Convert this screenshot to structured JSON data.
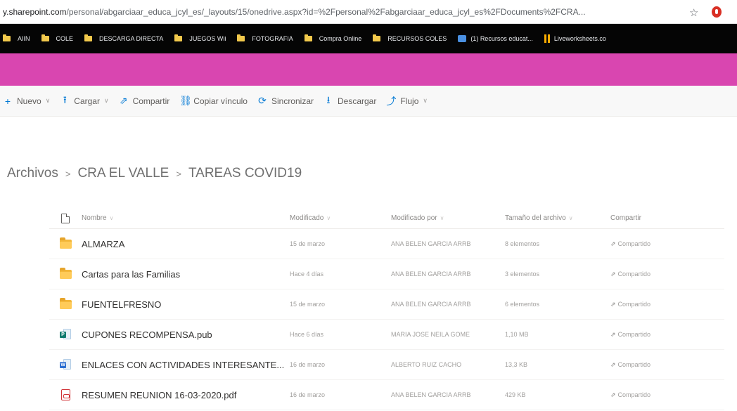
{
  "browser": {
    "url_host": "y.sharepoint.com",
    "url_path": "/personal/abgarciaar_educa_jcyl_es/_layouts/15/onedrive.aspx?id=%2Fpersonal%2Fabgarciaar_educa_jcyl_es%2FDocuments%2FCRA..."
  },
  "bookmarks": [
    {
      "label": "AIIN",
      "type": "folder"
    },
    {
      "label": "COLE",
      "type": "folder"
    },
    {
      "label": "DESCARGA DIRECTA",
      "type": "folder"
    },
    {
      "label": "JUEGOS Wii",
      "type": "folder"
    },
    {
      "label": "FOTOGRAFIA",
      "type": "folder"
    },
    {
      "label": "Compra Online",
      "type": "folder"
    },
    {
      "label": "RECURSOS COLES",
      "type": "folder"
    },
    {
      "label": "(1) Recursos educat...",
      "type": "image"
    },
    {
      "label": "Liveworksheets.co",
      "type": "bars"
    }
  ],
  "toolbar": {
    "new": "Nuevo",
    "upload": "Cargar",
    "share": "Compartir",
    "copy_link": "Copiar vínculo",
    "sync": "Sincronizar",
    "download": "Descargar",
    "flow": "Flujo"
  },
  "breadcrumb": {
    "root": "Archivos",
    "parent": "CRA EL VALLE",
    "current": "TAREAS COVID19"
  },
  "columns": {
    "name": "Nombre",
    "modified": "Modificado",
    "modified_by": "Modificado por",
    "size": "Tamaño del archivo",
    "sharing": "Compartir"
  },
  "files": [
    {
      "type": "folder",
      "name": "ALMARZA",
      "modified": "15 de marzo",
      "modified_by": "ANA BELEN GARCIA ARRB",
      "size": "8 elementos",
      "sharing": "Compartido"
    },
    {
      "type": "folder",
      "name": "Cartas para las Familias",
      "modified": "Hace 4 días",
      "modified_by": "ANA BELEN GARCIA ARRB",
      "size": "3 elementos",
      "sharing": "Compartido"
    },
    {
      "type": "folder",
      "name": "FUENTELFRESNO",
      "modified": "15 de marzo",
      "modified_by": "ANA BELEN GARCIA ARRB",
      "size": "6 elementos",
      "sharing": "Compartido"
    },
    {
      "type": "pub",
      "name": "CUPONES RECOMPENSA.pub",
      "modified": "Hace 6 días",
      "modified_by": "MARIA JOSE NEILA GOME",
      "size": "1,10 MB",
      "sharing": "Compartido"
    },
    {
      "type": "doc",
      "name": "ENLACES CON ACTIVIDADES INTERESANTE...",
      "modified": "16 de marzo",
      "modified_by": "ALBERTO RUIZ CACHO",
      "size": "13,3 KB",
      "sharing": "Compartido"
    },
    {
      "type": "pdf",
      "name": "RESUMEN REUNION 16-03-2020.pdf",
      "modified": "16 de marzo",
      "modified_by": "ANA BELEN GARCIA ARRB",
      "size": "429 KB",
      "sharing": "Compartido"
    }
  ],
  "colors": {
    "suite_header": "#d946b0",
    "bookmarks_bar": "#050505",
    "accent": "#0078d4",
    "folder": "#ffcb59"
  }
}
